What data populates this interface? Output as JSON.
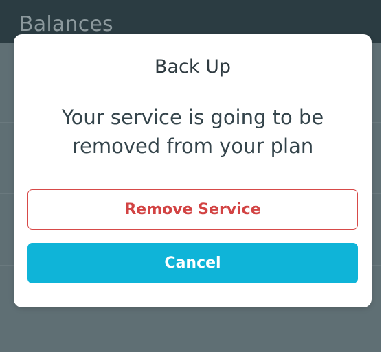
{
  "background": {
    "header_title": "Balances"
  },
  "dialog": {
    "title": "Back Up",
    "message": "Your service is going to be removed from your plan",
    "remove_label": "Remove Service",
    "cancel_label": "Cancel"
  },
  "colors": {
    "accent": "#0fb4d8",
    "danger": "#d24343",
    "overlay": "#5f6f74",
    "header": "#2b3c42"
  }
}
